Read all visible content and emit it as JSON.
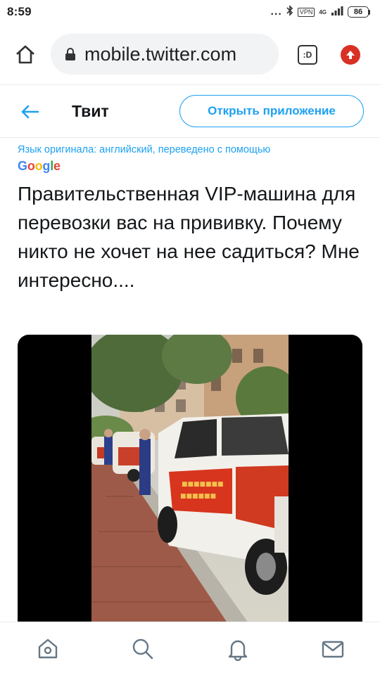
{
  "status_bar": {
    "time": "8:59",
    "dots": "...",
    "vpn": "VPN",
    "network": "4G",
    "battery": "86"
  },
  "browser": {
    "url": "mobile.twitter.com",
    "tabs_label": ":D",
    "icons": [
      "home-icon",
      "lock-icon",
      "tabs-icon",
      "update-icon"
    ]
  },
  "header": {
    "title": "Твит",
    "open_app": "Открыть приложение"
  },
  "translation": {
    "note": "Язык оригинала: английский, переведено с помощью",
    "provider": "Google"
  },
  "tweet": {
    "text": "Правительственная VIP-машина для перевозки вас на прививку. Почему никто не хочет на нее садиться? Мне интересно...."
  },
  "bottom_nav": {
    "icons": [
      "home-icon",
      "search-icon",
      "notifications-icon",
      "messages-icon"
    ]
  },
  "colors": {
    "accent": "#1da1f2",
    "update_badge": "#d93025",
    "text": "#14171a"
  }
}
